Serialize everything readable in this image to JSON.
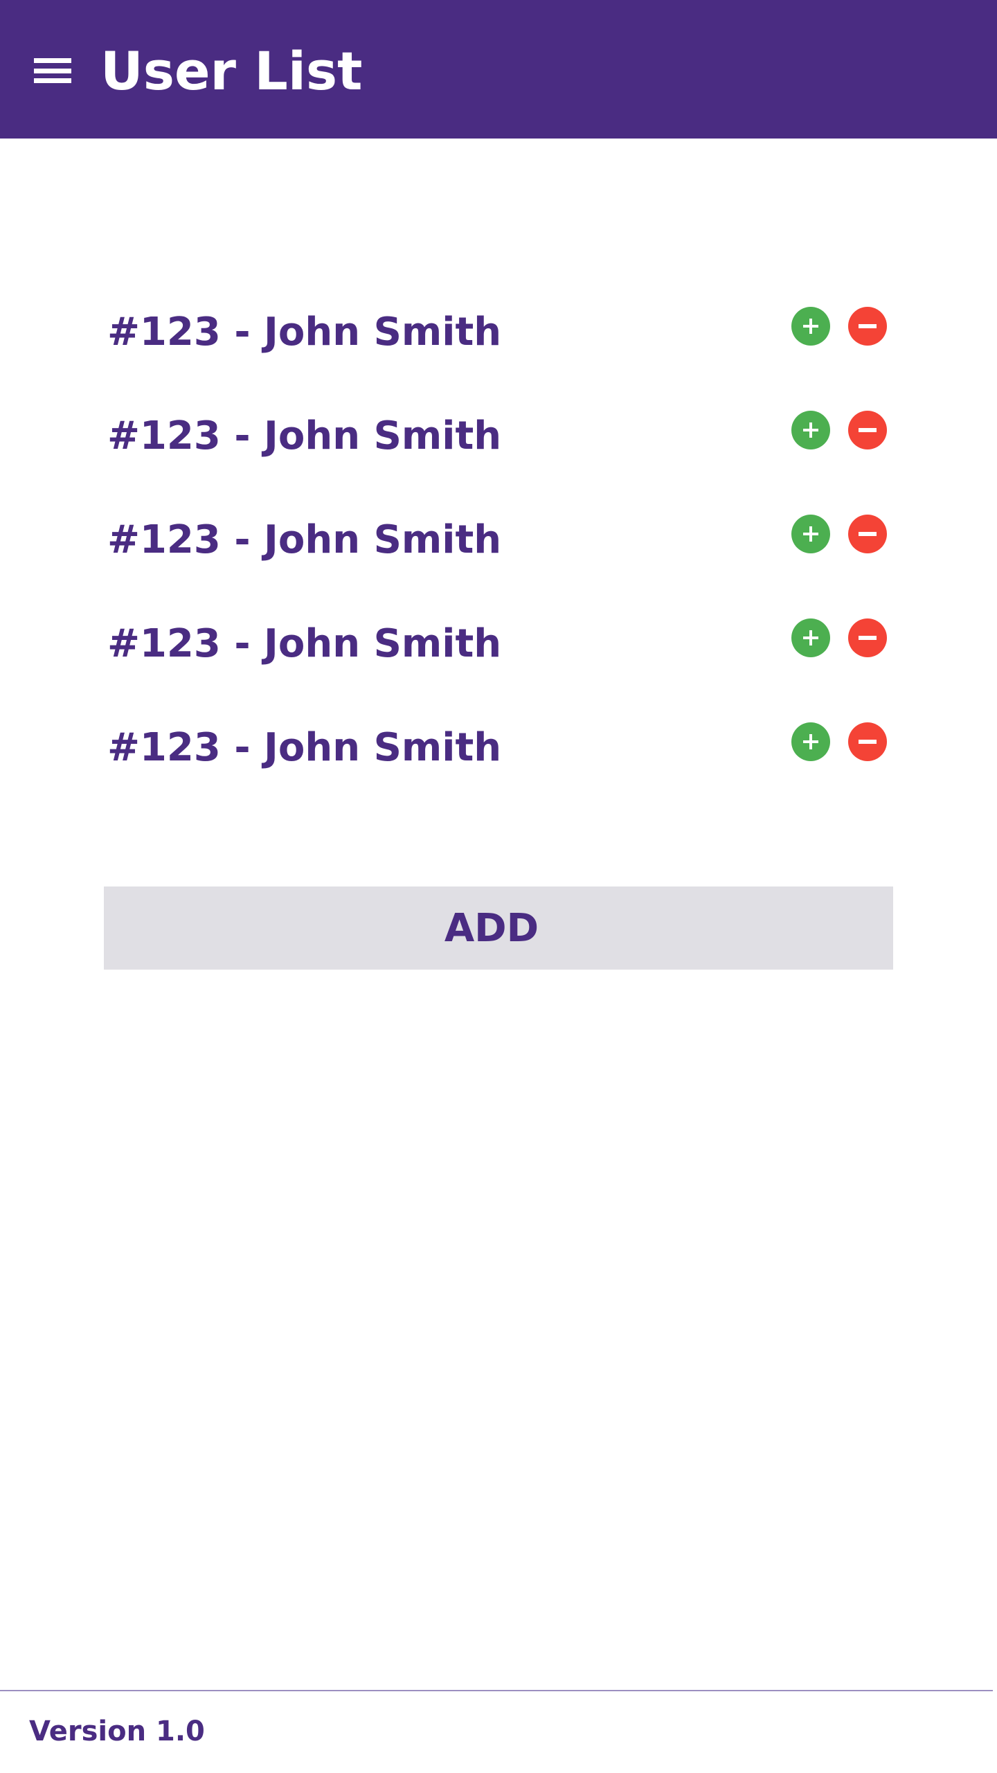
{
  "app_bar": {
    "title": "User List",
    "background_color": "#4a2c82",
    "menu_icon": "hamburger-menu-icon"
  },
  "users": [
    {
      "label": "#123 - John Smith"
    },
    {
      "label": "#123 - John Smith"
    },
    {
      "label": "#123 - John Smith"
    },
    {
      "label": "#123 - John Smith"
    },
    {
      "label": "#123 - John Smith"
    }
  ],
  "row_actions": {
    "add_icon": "plus-circle-icon",
    "add_color": "#4caf50",
    "remove_icon": "minus-circle-icon",
    "remove_color": "#f44336"
  },
  "add_button": {
    "label": "ADD",
    "background_color": "#e0dfe4"
  },
  "footer": {
    "version": "Version 1.0"
  },
  "colors": {
    "primary": "#4a2c82",
    "text": "#4a2c82"
  }
}
